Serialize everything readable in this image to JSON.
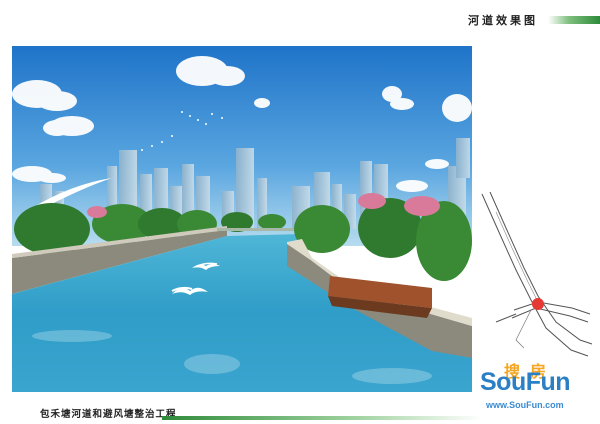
{
  "header": {
    "title": "河道效果图"
  },
  "footer": {
    "project_title": "包禾塘河道和避风塘整治工程"
  },
  "watermark": {
    "chinese": "搜房",
    "brand": "SouFun",
    "url": "www.SouFun.com"
  },
  "colors": {
    "accent_green": "#2e8b3a",
    "brand_blue": "#2b7fc4",
    "brand_orange": "#f5a623",
    "location_marker": "#e53935"
  },
  "icons": {
    "location_marker": "location-marker-icon"
  }
}
